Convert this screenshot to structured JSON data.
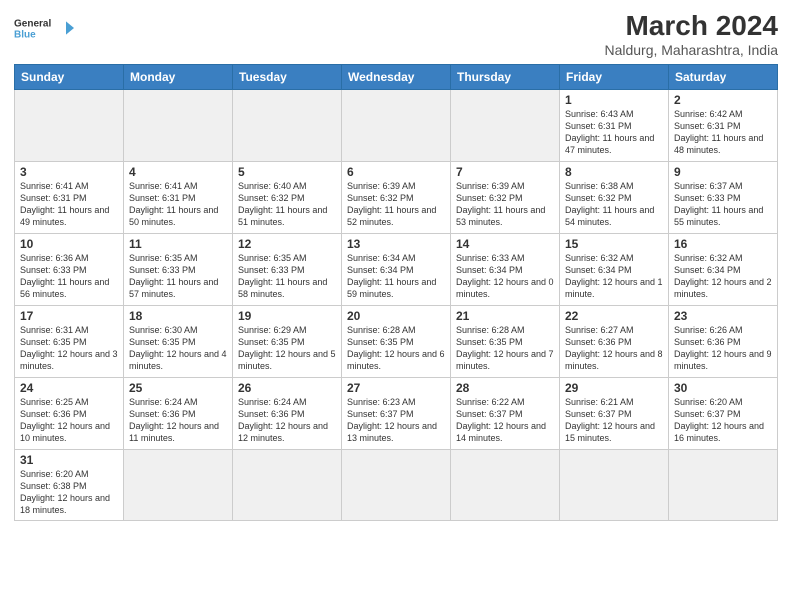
{
  "header": {
    "logo_general": "General",
    "logo_blue": "Blue",
    "month_year": "March 2024",
    "location": "Naldurg, Maharashtra, India"
  },
  "weekdays": [
    "Sunday",
    "Monday",
    "Tuesday",
    "Wednesday",
    "Thursday",
    "Friday",
    "Saturday"
  ],
  "weeks": [
    [
      {
        "day": "",
        "info": ""
      },
      {
        "day": "",
        "info": ""
      },
      {
        "day": "",
        "info": ""
      },
      {
        "day": "",
        "info": ""
      },
      {
        "day": "",
        "info": ""
      },
      {
        "day": "1",
        "info": "Sunrise: 6:43 AM\nSunset: 6:31 PM\nDaylight: 11 hours\nand 47 minutes."
      },
      {
        "day": "2",
        "info": "Sunrise: 6:42 AM\nSunset: 6:31 PM\nDaylight: 11 hours\nand 48 minutes."
      }
    ],
    [
      {
        "day": "3",
        "info": "Sunrise: 6:41 AM\nSunset: 6:31 PM\nDaylight: 11 hours\nand 49 minutes."
      },
      {
        "day": "4",
        "info": "Sunrise: 6:41 AM\nSunset: 6:31 PM\nDaylight: 11 hours\nand 50 minutes."
      },
      {
        "day": "5",
        "info": "Sunrise: 6:40 AM\nSunset: 6:32 PM\nDaylight: 11 hours\nand 51 minutes."
      },
      {
        "day": "6",
        "info": "Sunrise: 6:39 AM\nSunset: 6:32 PM\nDaylight: 11 hours\nand 52 minutes."
      },
      {
        "day": "7",
        "info": "Sunrise: 6:39 AM\nSunset: 6:32 PM\nDaylight: 11 hours\nand 53 minutes."
      },
      {
        "day": "8",
        "info": "Sunrise: 6:38 AM\nSunset: 6:32 PM\nDaylight: 11 hours\nand 54 minutes."
      },
      {
        "day": "9",
        "info": "Sunrise: 6:37 AM\nSunset: 6:33 PM\nDaylight: 11 hours\nand 55 minutes."
      }
    ],
    [
      {
        "day": "10",
        "info": "Sunrise: 6:36 AM\nSunset: 6:33 PM\nDaylight: 11 hours\nand 56 minutes."
      },
      {
        "day": "11",
        "info": "Sunrise: 6:35 AM\nSunset: 6:33 PM\nDaylight: 11 hours\nand 57 minutes."
      },
      {
        "day": "12",
        "info": "Sunrise: 6:35 AM\nSunset: 6:33 PM\nDaylight: 11 hours\nand 58 minutes."
      },
      {
        "day": "13",
        "info": "Sunrise: 6:34 AM\nSunset: 6:34 PM\nDaylight: 11 hours\nand 59 minutes."
      },
      {
        "day": "14",
        "info": "Sunrise: 6:33 AM\nSunset: 6:34 PM\nDaylight: 12 hours\nand 0 minutes."
      },
      {
        "day": "15",
        "info": "Sunrise: 6:32 AM\nSunset: 6:34 PM\nDaylight: 12 hours\nand 1 minute."
      },
      {
        "day": "16",
        "info": "Sunrise: 6:32 AM\nSunset: 6:34 PM\nDaylight: 12 hours\nand 2 minutes."
      }
    ],
    [
      {
        "day": "17",
        "info": "Sunrise: 6:31 AM\nSunset: 6:35 PM\nDaylight: 12 hours\nand 3 minutes."
      },
      {
        "day": "18",
        "info": "Sunrise: 6:30 AM\nSunset: 6:35 PM\nDaylight: 12 hours\nand 4 minutes."
      },
      {
        "day": "19",
        "info": "Sunrise: 6:29 AM\nSunset: 6:35 PM\nDaylight: 12 hours\nand 5 minutes."
      },
      {
        "day": "20",
        "info": "Sunrise: 6:28 AM\nSunset: 6:35 PM\nDaylight: 12 hours\nand 6 minutes."
      },
      {
        "day": "21",
        "info": "Sunrise: 6:28 AM\nSunset: 6:35 PM\nDaylight: 12 hours\nand 7 minutes."
      },
      {
        "day": "22",
        "info": "Sunrise: 6:27 AM\nSunset: 6:36 PM\nDaylight: 12 hours\nand 8 minutes."
      },
      {
        "day": "23",
        "info": "Sunrise: 6:26 AM\nSunset: 6:36 PM\nDaylight: 12 hours\nand 9 minutes."
      }
    ],
    [
      {
        "day": "24",
        "info": "Sunrise: 6:25 AM\nSunset: 6:36 PM\nDaylight: 12 hours\nand 10 minutes."
      },
      {
        "day": "25",
        "info": "Sunrise: 6:24 AM\nSunset: 6:36 PM\nDaylight: 12 hours\nand 11 minutes."
      },
      {
        "day": "26",
        "info": "Sunrise: 6:24 AM\nSunset: 6:36 PM\nDaylight: 12 hours\nand 12 minutes."
      },
      {
        "day": "27",
        "info": "Sunrise: 6:23 AM\nSunset: 6:37 PM\nDaylight: 12 hours\nand 13 minutes."
      },
      {
        "day": "28",
        "info": "Sunrise: 6:22 AM\nSunset: 6:37 PM\nDaylight: 12 hours\nand 14 minutes."
      },
      {
        "day": "29",
        "info": "Sunrise: 6:21 AM\nSunset: 6:37 PM\nDaylight: 12 hours\nand 15 minutes."
      },
      {
        "day": "30",
        "info": "Sunrise: 6:20 AM\nSunset: 6:37 PM\nDaylight: 12 hours\nand 16 minutes."
      }
    ],
    [
      {
        "day": "31",
        "info": "Sunrise: 6:20 AM\nSunset: 6:38 PM\nDaylight: 12 hours\nand 18 minutes."
      },
      {
        "day": "",
        "info": ""
      },
      {
        "day": "",
        "info": ""
      },
      {
        "day": "",
        "info": ""
      },
      {
        "day": "",
        "info": ""
      },
      {
        "day": "",
        "info": ""
      },
      {
        "day": "",
        "info": ""
      }
    ]
  ]
}
